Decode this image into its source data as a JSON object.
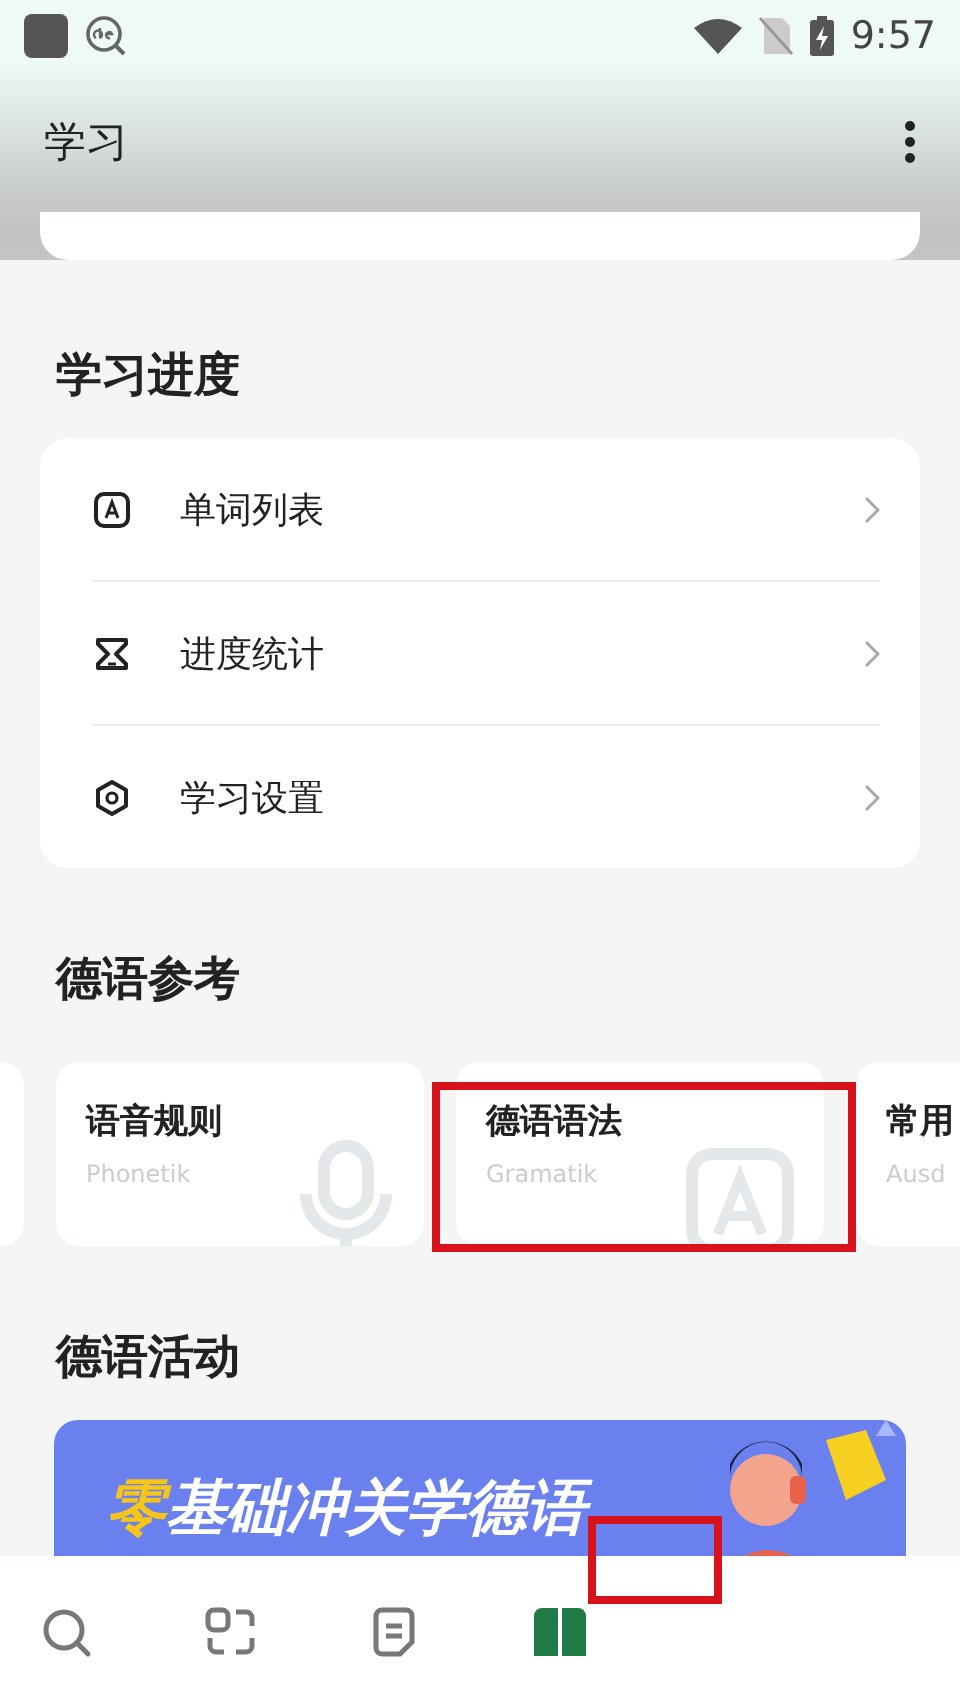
{
  "status_bar": {
    "time": "9:57"
  },
  "app_bar": {
    "title": "学习"
  },
  "sections": [
    {
      "kind": "list",
      "title": "学习进度",
      "items": [
        {
          "label": "单词列表"
        },
        {
          "label": "进度统计"
        },
        {
          "label": "学习设置"
        }
      ]
    },
    {
      "kind": "cards",
      "title": "德语参考",
      "cards": [
        {
          "title": "语音规则",
          "subtitle": "Phonetik"
        },
        {
          "title": "德语语法",
          "subtitle": "Gramatik"
        },
        {
          "title": "常用",
          "subtitle": "Ausd"
        }
      ]
    },
    {
      "kind": "banner",
      "title": "德语活动",
      "banner": {
        "highlight": "零",
        "text": "基础冲关学德语"
      }
    }
  ],
  "bottom_nav": [
    {
      "selected": false
    },
    {
      "selected": false
    },
    {
      "selected": false
    },
    {
      "selected": true
    }
  ]
}
